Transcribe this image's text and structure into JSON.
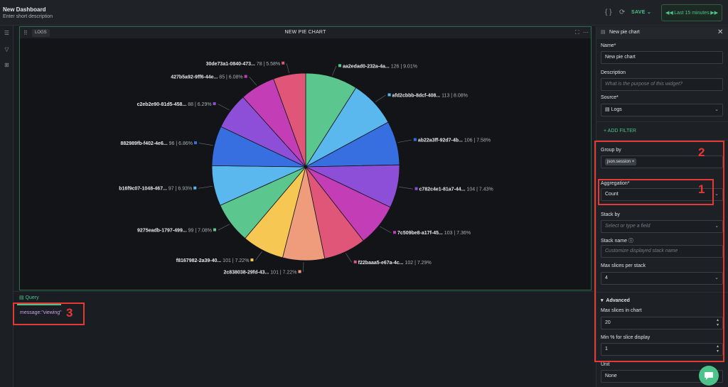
{
  "header": {
    "title": "New Dashboard",
    "subtitle": "Enter short description",
    "save_label": "SAVE",
    "time_range": "Last 15 minutes"
  },
  "widget": {
    "source_tag": "LOGS",
    "title": "NEW PIE CHART"
  },
  "chart_data": {
    "type": "pie",
    "slices": [
      {
        "label": "aa2edad0-232a-4a...",
        "value": 126,
        "percent": "9.01%",
        "color": "#5cc68f"
      },
      {
        "label": "afd2cbbb-8dcf-408...",
        "value": 113,
        "percent": "8.08%",
        "color": "#5ab8ef"
      },
      {
        "label": "ab22a3ff-92d7-4b...",
        "value": 106,
        "percent": "7.58%",
        "color": "#386fe0"
      },
      {
        "label": "c782c4e1-81a7-44...",
        "value": 104,
        "percent": "7.43%",
        "color": "#8e4fd8"
      },
      {
        "label": "7c509be8-a17f-45...",
        "value": 103,
        "percent": "7.36%",
        "color": "#c23db6"
      },
      {
        "label": "f22baaa5-e67a-4c...",
        "value": 102,
        "percent": "7.29%",
        "color": "#df5678"
      },
      {
        "label": "2c838038-29fd-43...",
        "value": 101,
        "percent": "7.22%",
        "color": "#ee9c7c"
      },
      {
        "label": "f8167982-2a39-40...",
        "value": 101,
        "percent": "7.22%",
        "color": "#f6c753"
      },
      {
        "label": "9275eadb-1797-499...",
        "value": 99,
        "percent": "7.08%",
        "color": "#5cc68f"
      },
      {
        "label": "b16f9c07-1048-467...",
        "value": 97,
        "percent": "6.93%",
        "color": "#5ab8ef"
      },
      {
        "label": "882989fb-f402-4e6...",
        "value": 96,
        "percent": "6.86%",
        "color": "#386fe0"
      },
      {
        "label": "c2eb2e90-81d5-458...",
        "value": 88,
        "percent": "6.29%",
        "color": "#8e4fd8"
      },
      {
        "label": "427b5a92-9ff6-44e...",
        "value": 85,
        "percent": "6.08%",
        "color": "#c23db6"
      },
      {
        "label": "30de73a1-0840-473...",
        "value": 78,
        "percent": "5.58%",
        "color": "#df5678"
      }
    ]
  },
  "query": {
    "tab_label": "Query",
    "text": "message:\"viewing\""
  },
  "panel": {
    "title": "New pie chart",
    "name_label": "Name*",
    "name_value": "New pie chart",
    "description_label": "Description",
    "description_placeholder": "What is the purpose of this widget?",
    "source_label": "Source*",
    "source_value": "Logs",
    "add_filter": "ADD FILTER",
    "group_by_label": "Group by",
    "group_by_chip": "json.session",
    "aggregation_label": "Aggregation*",
    "aggregation_value": "Count",
    "stack_by_label": "Stack by",
    "stack_by_placeholder": "Select or type a field",
    "stack_name_label": "Stack name",
    "stack_name_placeholder": "Customize displayed stack name",
    "max_slices_stack_label": "Max slices per stack",
    "max_slices_stack_value": "4",
    "advanced_label": "Advanced",
    "max_slices_chart_label": "Max slices in chart",
    "max_slices_chart_value": "20",
    "min_percent_label": "Min % for slice display",
    "min_percent_value": "1",
    "unit_label": "Unit",
    "unit_value": "None"
  },
  "annotations": {
    "one": "1",
    "two": "2",
    "three": "3",
    "color": "#e53935"
  }
}
